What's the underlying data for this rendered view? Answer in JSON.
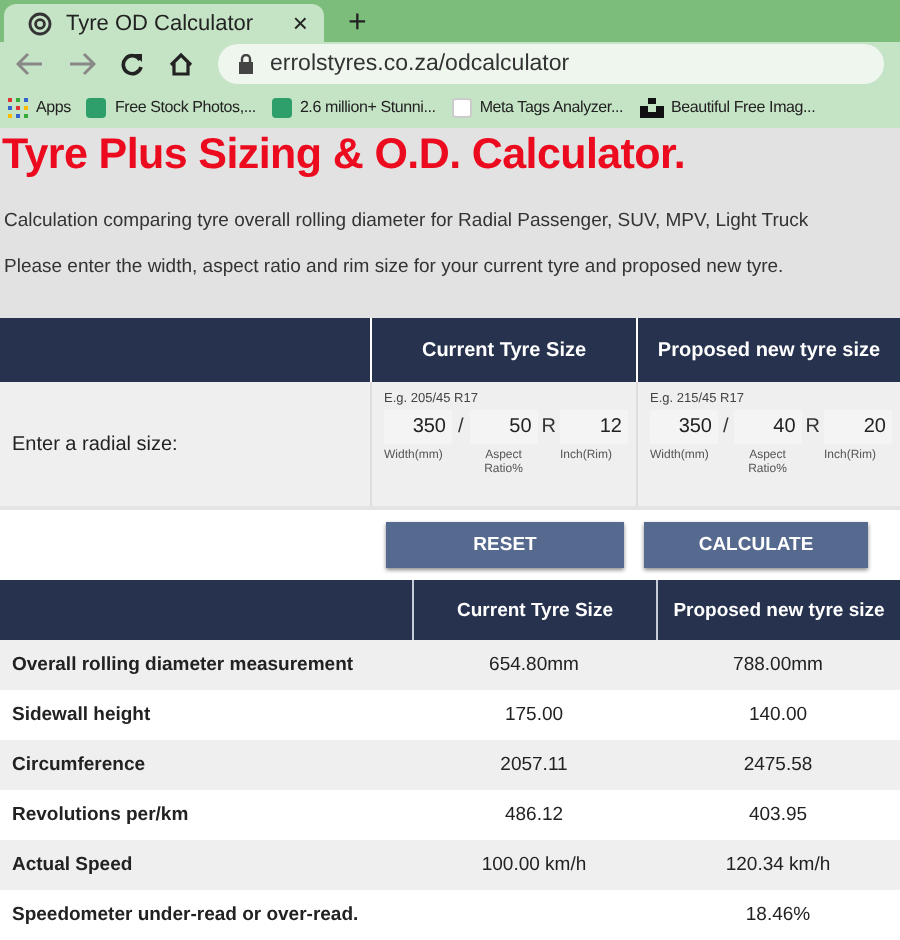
{
  "browser": {
    "tab": {
      "title": "Tyre OD Calculator",
      "close": "×"
    },
    "new_tab": "+",
    "address": "errolstyres.co.za/odcalculator",
    "bookmarks": [
      {
        "label": "Apps",
        "kind": "apps"
      },
      {
        "label": "Free Stock Photos,...",
        "kind": "p"
      },
      {
        "label": "2.6 million+ Stunni...",
        "kind": "px"
      },
      {
        "label": "Meta Tags Analyzer...",
        "kind": "meta"
      },
      {
        "label": "Beautiful Free Imag...",
        "kind": "unsplash"
      }
    ]
  },
  "page": {
    "title": "Tyre Plus Sizing & O.D. Calculator.",
    "intro": [
      "Calculation comparing tyre overall rolling diameter for Radial Passenger, SUV, MPV, Light Truck",
      "Please enter the width, aspect ratio and rim size for your current tyre and proposed new tyre."
    ]
  },
  "input_table": {
    "columns": [
      "Current Tyre Size",
      "Proposed new tyre size"
    ],
    "row_label": "Enter a radial size:",
    "tyres": [
      {
        "example": "E.g. 205/45 R17",
        "fields": [
          {
            "value": "350",
            "caption": "Width(mm)"
          },
          {
            "value": "50",
            "caption": "Aspect Ratio%"
          },
          {
            "value": "12",
            "caption": "Inch(Rim)"
          }
        ],
        "separators": [
          "/",
          "R"
        ]
      },
      {
        "example": "E.g. 215/45 R17",
        "fields": [
          {
            "value": "350",
            "caption": "Width(mm)"
          },
          {
            "value": "40",
            "caption": "Aspect Ratio%"
          },
          {
            "value": "20",
            "caption": "Inch(Rim)"
          }
        ],
        "separators": [
          "/",
          "R"
        ]
      }
    ]
  },
  "buttons": [
    "RESET",
    "CALCULATE"
  ],
  "results": {
    "columns": [
      "Current Tyre Size",
      "Proposed new tyre size"
    ],
    "rows": [
      {
        "label": "Overall rolling diameter measurement",
        "current": "654.80mm",
        "proposed": "788.00mm"
      },
      {
        "label": "Sidewall height",
        "current": "175.00",
        "proposed": "140.00"
      },
      {
        "label": "Circumference",
        "current": "2057.11",
        "proposed": "2475.58"
      },
      {
        "label": "Revolutions per/km",
        "current": "486.12",
        "proposed": "403.95"
      },
      {
        "label": "Actual Speed",
        "current": "100.00 km/h",
        "proposed": "120.34 km/h"
      },
      {
        "label": "Speedometer under-read or over-read.",
        "proposed": "18.46%"
      }
    ]
  }
}
